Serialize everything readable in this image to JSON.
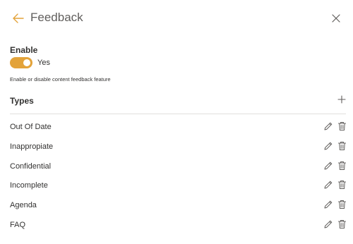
{
  "header": {
    "title": "Feedback",
    "back_icon": "arrow-left-icon",
    "close_icon": "close-icon",
    "accent_color": "#e3a33a"
  },
  "enable": {
    "label": "Enable",
    "toggle_on": true,
    "toggle_text": "Yes",
    "help_text": "Enable or disable content feedback feature"
  },
  "types": {
    "title": "Types",
    "add_icon": "plus-icon",
    "items": [
      {
        "label": "Out Of Date"
      },
      {
        "label": "Inappropiate"
      },
      {
        "label": "Confidential"
      },
      {
        "label": "Incomplete"
      },
      {
        "label": "Agenda"
      },
      {
        "label": "FAQ"
      }
    ]
  }
}
